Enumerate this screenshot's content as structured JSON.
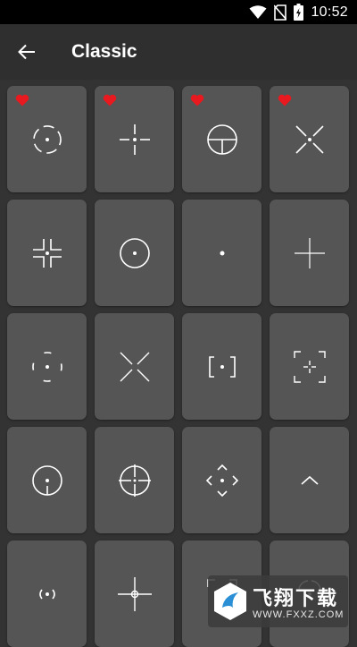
{
  "status_bar": {
    "time": "10:52",
    "icons": [
      "wifi-icon",
      "no-sim-icon",
      "battery-charging-icon"
    ]
  },
  "app_bar": {
    "back_icon": "arrow-back-icon",
    "title": "Classic"
  },
  "crosshairs": [
    {
      "icon": "circle-dashed-dot",
      "favorite": true
    },
    {
      "icon": "cross-gap-dot",
      "favorite": true
    },
    {
      "icon": "circle-half-cross",
      "favorite": true
    },
    {
      "icon": "x-cross-dot",
      "favorite": true
    },
    {
      "icon": "corner-brackets-dot",
      "favorite": false
    },
    {
      "icon": "circle-dot",
      "favorite": false
    },
    {
      "icon": "dot",
      "favorite": false
    },
    {
      "icon": "thin-cross",
      "favorite": false
    },
    {
      "icon": "arc-segments-dot",
      "favorite": false
    },
    {
      "icon": "x-gap",
      "favorite": false
    },
    {
      "icon": "square-brackets-dot",
      "favorite": false
    },
    {
      "icon": "corner-frame-cross",
      "favorite": false
    },
    {
      "icon": "circle-dot-tick",
      "favorite": false
    },
    {
      "icon": "scope-circle-cross",
      "favorite": false
    },
    {
      "icon": "diamond-chevrons-dot",
      "favorite": false
    },
    {
      "icon": "chevron-up",
      "favorite": false
    },
    {
      "icon": "parentheses-dot",
      "favorite": false
    },
    {
      "icon": "cross-small-circle",
      "favorite": false
    },
    {
      "icon": "partial-frame",
      "favorite": false
    },
    {
      "icon": "partial-arc",
      "favorite": false
    }
  ],
  "colors": {
    "background": "#333333",
    "tile": "#555555",
    "app_bar": "#2f2f2f",
    "favorite_heart": "#e8191f",
    "crosshair_stroke": "#ffffff"
  },
  "watermark": {
    "text": "飞翔下载",
    "url": "WWW.FXXZ.COM"
  }
}
